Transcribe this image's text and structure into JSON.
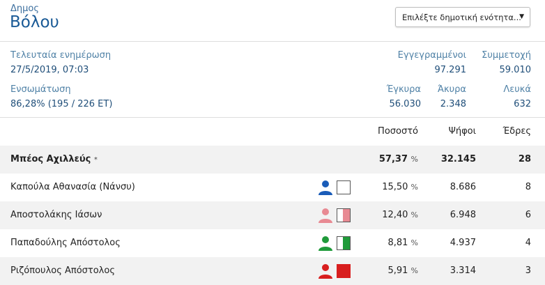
{
  "header": {
    "municipality_label": "Δημος",
    "municipality_name": "Βόλου",
    "select_placeholder": "Επιλέξτε δημοτική ενότητα..."
  },
  "stats": {
    "updated_label": "Τελευταία ενημέρωση",
    "updated_value": "27/5/2019, 07:03",
    "registered_label": "Εγγεγραμμένοι",
    "registered_value": "97.291",
    "turnout_label": "Συμμετοχή",
    "turnout_value": "59.010",
    "incorporation_label": "Ενσωμάτωση",
    "incorporation_value": "86,28% (195 / 226 ΕΤ)",
    "valid_label": "Έγκυρα",
    "valid_value": "56.030",
    "invalid_label": "Άκυρα",
    "invalid_value": "2.348",
    "blank_label": "Λευκά",
    "blank_value": "632"
  },
  "table": {
    "col_percent": "Ποσοστό",
    "col_votes": "Ψήφοι",
    "col_seats": "Έδρες",
    "percent_unit": "%",
    "rows": [
      {
        "name": "Μπέος Αχιλλεύς",
        "marker": "*",
        "percent": "57,37",
        "votes": "32.145",
        "seats": "28"
      },
      {
        "name": "Καπούλα Αθανασία (Νάνσυ)",
        "percent": "15,50",
        "votes": "8.686",
        "seats": "8"
      },
      {
        "name": "Αποστολάκης Ιάσων",
        "percent": "12,40",
        "votes": "6.948",
        "seats": "6"
      },
      {
        "name": "Παπαδούλης Απόστολος",
        "percent": "8,81",
        "votes": "4.937",
        "seats": "4"
      },
      {
        "name": "Ριζόπουλος Απόστολος",
        "percent": "5,91",
        "votes": "3.314",
        "seats": "3"
      }
    ]
  },
  "colors": {
    "blue": "#1a5cb8",
    "pink": "#e88a93",
    "green": "#1f9a3a",
    "red": "#d81e1e"
  }
}
